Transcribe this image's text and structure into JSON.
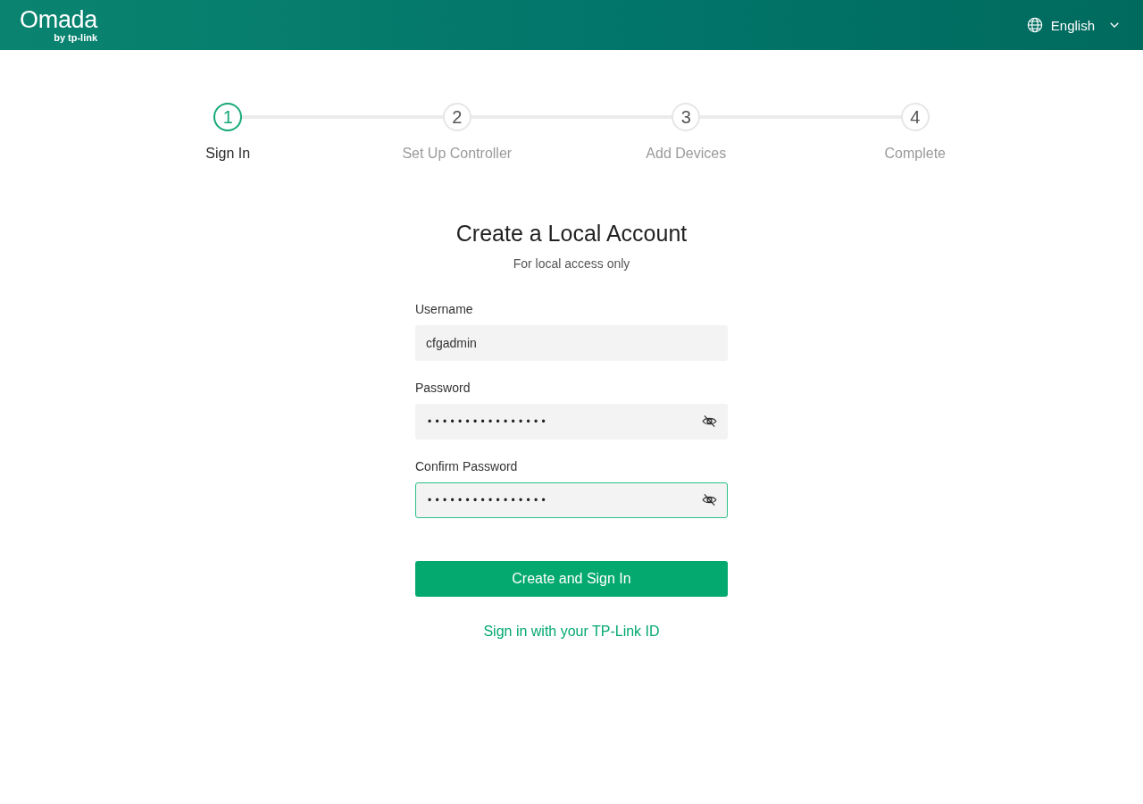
{
  "header": {
    "logo": {
      "name": "Omada",
      "tagline": "by tp-link"
    },
    "language": {
      "label": "English"
    }
  },
  "steps": [
    {
      "number": "1",
      "label": "Sign In",
      "active": true
    },
    {
      "number": "2",
      "label": "Set Up Controller",
      "active": false
    },
    {
      "number": "3",
      "label": "Add Devices",
      "active": false
    },
    {
      "number": "4",
      "label": "Complete",
      "active": false
    }
  ],
  "form": {
    "title": "Create a Local Account",
    "subtitle": "For local access only",
    "fields": [
      {
        "label": "Username",
        "kind": "text",
        "value": "cfgadmin",
        "focused": false
      },
      {
        "label": "Password",
        "kind": "password",
        "value": "••••••••••••••••",
        "focused": false
      },
      {
        "label": "Confirm Password",
        "kind": "password",
        "value": "••••••••••••••••",
        "focused": true
      }
    ],
    "submit": "Create and Sign In",
    "link": "Sign in with your TP-Link ID"
  }
}
